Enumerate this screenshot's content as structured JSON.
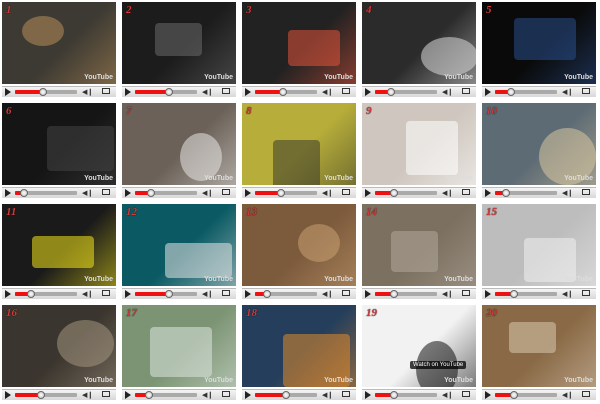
{
  "brand": "YouTube",
  "overlay_text": "Watch on YouTube",
  "videos": [
    {
      "num": "1",
      "progress": 0.45,
      "bg": "#3d3a33",
      "fg": "#b78d57",
      "scene": "person playing zither on table"
    },
    {
      "num": "2",
      "progress": 0.55,
      "bg": "#1c1c1c",
      "fg": "#6a6a6a",
      "scene": "amp and guitarist"
    },
    {
      "num": "3",
      "progress": 0.45,
      "bg": "#222222",
      "fg": "#e0533a",
      "scene": "launchpad glowing square"
    },
    {
      "num": "4",
      "progress": 0.25,
      "bg": "#2b2b2b",
      "fg": "#d9d9d9",
      "scene": "keyboard piano close-up"
    },
    {
      "num": "5",
      "progress": 0.25,
      "bg": "#0a0a0a",
      "fg": "#2a4f8c",
      "scene": "person with harmonica"
    },
    {
      "num": "6",
      "progress": 0.15,
      "bg": "#151515",
      "fg": "#444444",
      "scene": "bassist in dark room"
    },
    {
      "num": "7",
      "progress": 0.25,
      "bg": "#6b6158",
      "fg": "#e8e6e4",
      "scene": "person with megaphone"
    },
    {
      "num": "8",
      "progress": 0.42,
      "bg": "#b6ad3a",
      "fg": "#3a3a2a",
      "scene": "man against yellow wall"
    },
    {
      "num": "9",
      "progress": 0.3,
      "bg": "#cfc7bf",
      "fg": "#ffffff",
      "scene": "woman singing with keyboard"
    },
    {
      "num": "10",
      "progress": 0.18,
      "bg": "#5d6b74",
      "fg": "#d8c7a1",
      "scene": "banjo close-up"
    },
    {
      "num": "11",
      "progress": 0.25,
      "bg": "#1a1a1a",
      "fg": "#f2e419",
      "scene": "yellow sunset scene"
    },
    {
      "num": "12",
      "progress": 0.55,
      "bg": "#0b5a63",
      "fg": "#e6e6e6",
      "scene": "woman holding handheld device"
    },
    {
      "num": "13",
      "progress": 0.2,
      "bg": "#7c5a3c",
      "fg": "#c9a071",
      "scene": "acoustic guitar"
    },
    {
      "num": "14",
      "progress": 0.3,
      "bg": "#7c7060",
      "fg": "#b0a79a",
      "scene": "building facade"
    },
    {
      "num": "15",
      "progress": 0.3,
      "bg": "#bdbdbd",
      "fg": "#f0f0f0",
      "scene": "man with lap steel"
    },
    {
      "num": "16",
      "progress": 0.42,
      "bg": "#3a352e",
      "fg": "#a49580",
      "scene": "person at laptop"
    },
    {
      "num": "17",
      "progress": 0.22,
      "bg": "#7c9473",
      "fg": "#dce6e0",
      "scene": "tree canopy"
    },
    {
      "num": "18",
      "progress": 0.5,
      "bg": "#243e5c",
      "fg": "#e28a2a",
      "scene": "synth panel lights"
    },
    {
      "num": "19",
      "progress": 0.3,
      "bg": "#f2f2f2",
      "fg": "#111111",
      "scene": "piano keys with hand"
    },
    {
      "num": "20",
      "progress": 0.3,
      "bg": "#8a6a46",
      "fg": "#d8c7b1",
      "scene": "violinist in room"
    }
  ]
}
